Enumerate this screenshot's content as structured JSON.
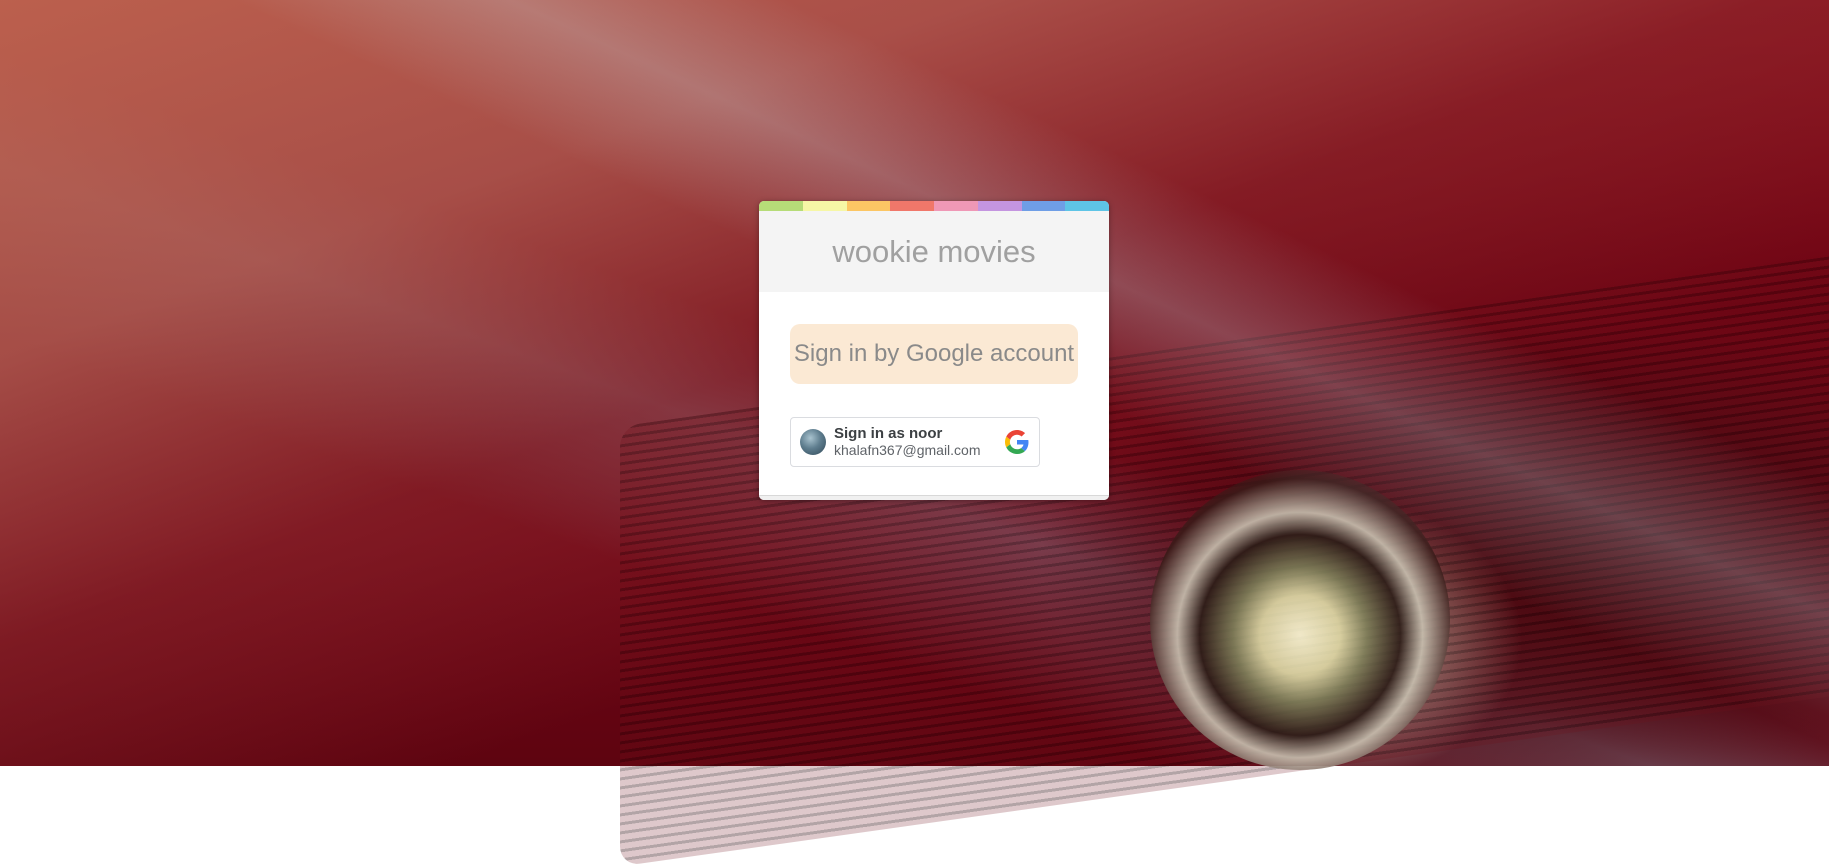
{
  "app": {
    "title": "wookie movies"
  },
  "color_bar": [
    "#b6dc78",
    "#f6f7a6",
    "#fcc664",
    "#f0776a",
    "#ef98b6",
    "#c495e0",
    "#6f9ee6",
    "#5ec4e6"
  ],
  "signin": {
    "google_button_label": "Sign in by Google account",
    "account_name_label": "Sign in as noor",
    "account_email": "khalafn367@gmail.com"
  },
  "icons": {
    "avatar": "user-avatar",
    "google": "google-g-icon"
  }
}
